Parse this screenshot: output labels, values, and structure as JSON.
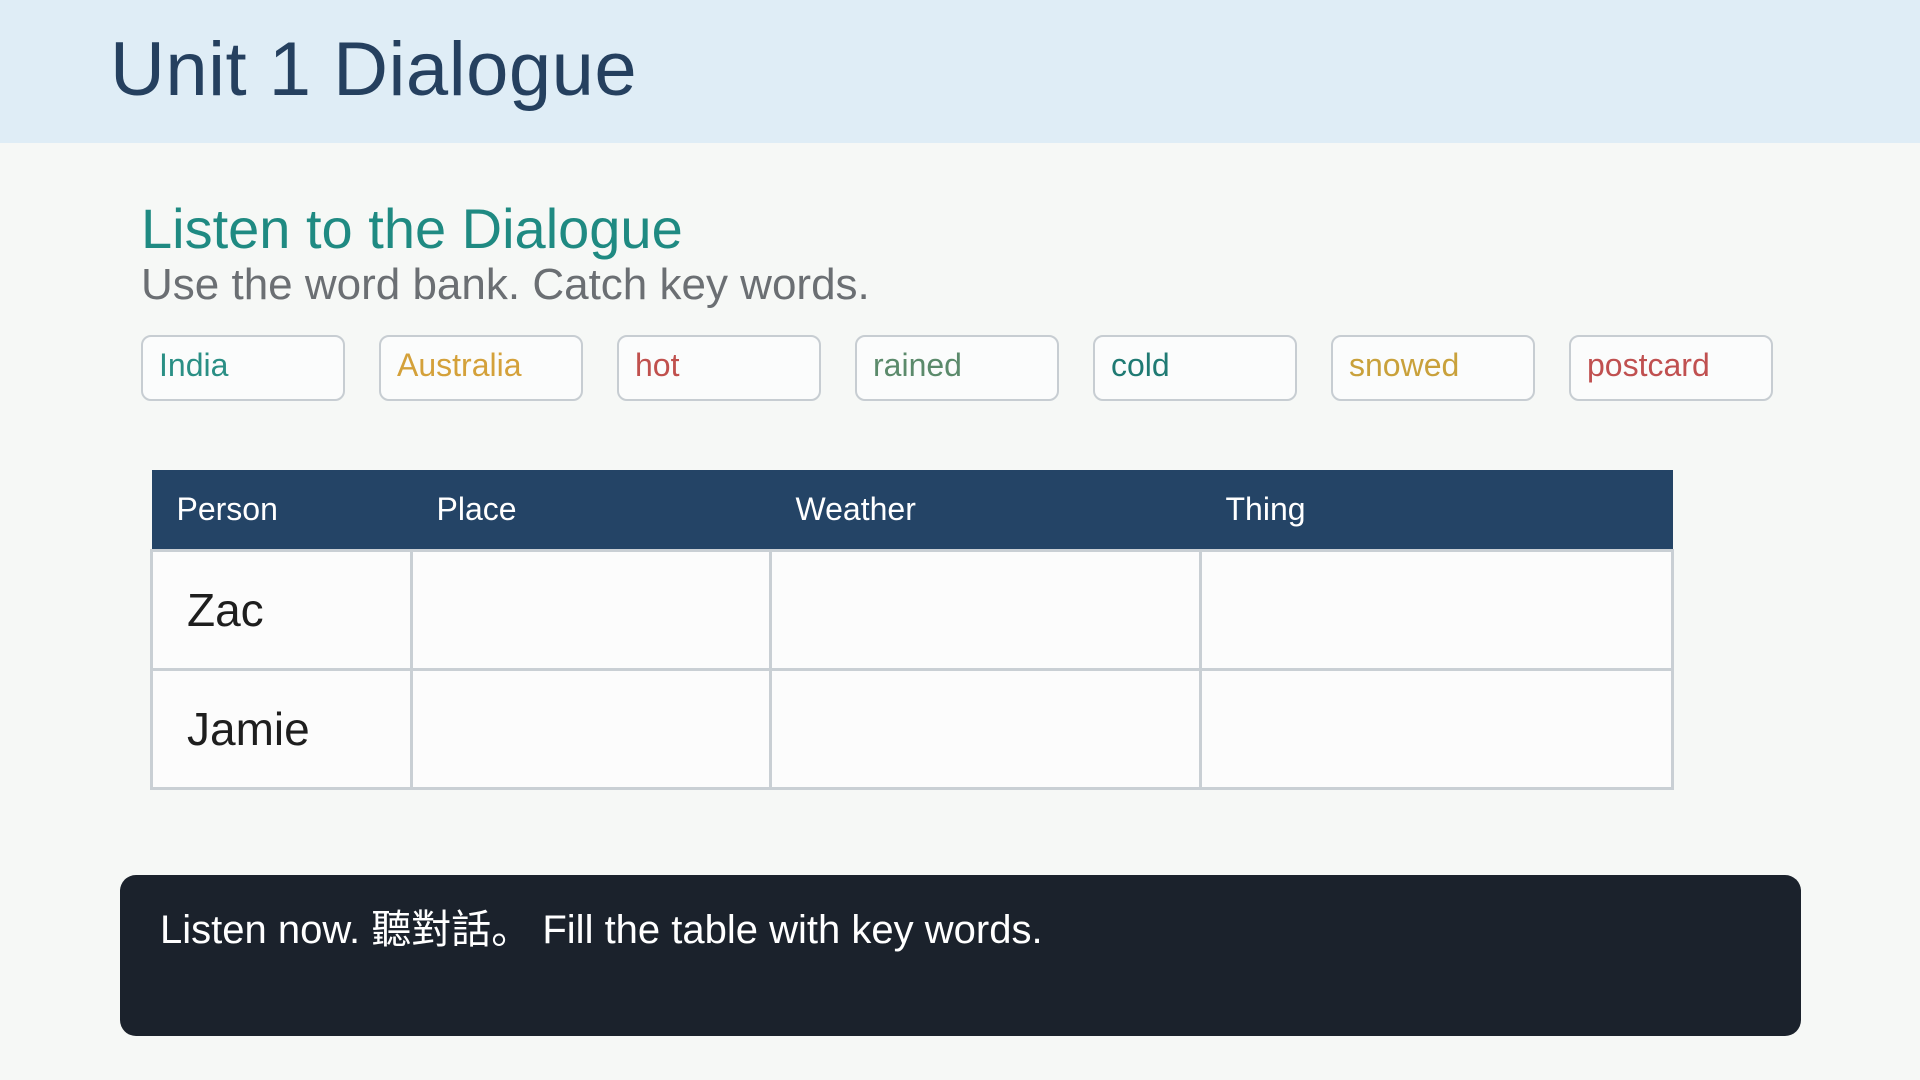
{
  "header": {
    "title": "Unit 1 Dialogue"
  },
  "section": {
    "title": "Listen to the Dialogue",
    "subtitle": "Use the word bank. Catch key words."
  },
  "word_bank": [
    {
      "word": "India",
      "color": "#2a8f85"
    },
    {
      "word": "Australia",
      "color": "#d4a13a"
    },
    {
      "word": "hot",
      "color": "#c0504d"
    },
    {
      "word": "rained",
      "color": "#5b8a6b"
    },
    {
      "word": "cold",
      "color": "#1f7a73"
    },
    {
      "word": "snowed",
      "color": "#c9a13b"
    },
    {
      "word": "postcard",
      "color": "#c05050"
    }
  ],
  "table": {
    "headers": [
      "Person",
      "Place",
      "Weather",
      "Thing"
    ],
    "rows": [
      [
        "Zac",
        "",
        "",
        ""
      ],
      [
        "Jamie",
        "",
        "",
        ""
      ]
    ]
  },
  "footer": {
    "instruction": "Listen now. 聽對話。 Fill the table with key words."
  },
  "colors": {
    "header_bg": "#dfedf6",
    "title": "#25405f",
    "accent_teal": "#1f8a82",
    "table_header_bg": "#244466",
    "footer_bg": "#1b222c"
  }
}
